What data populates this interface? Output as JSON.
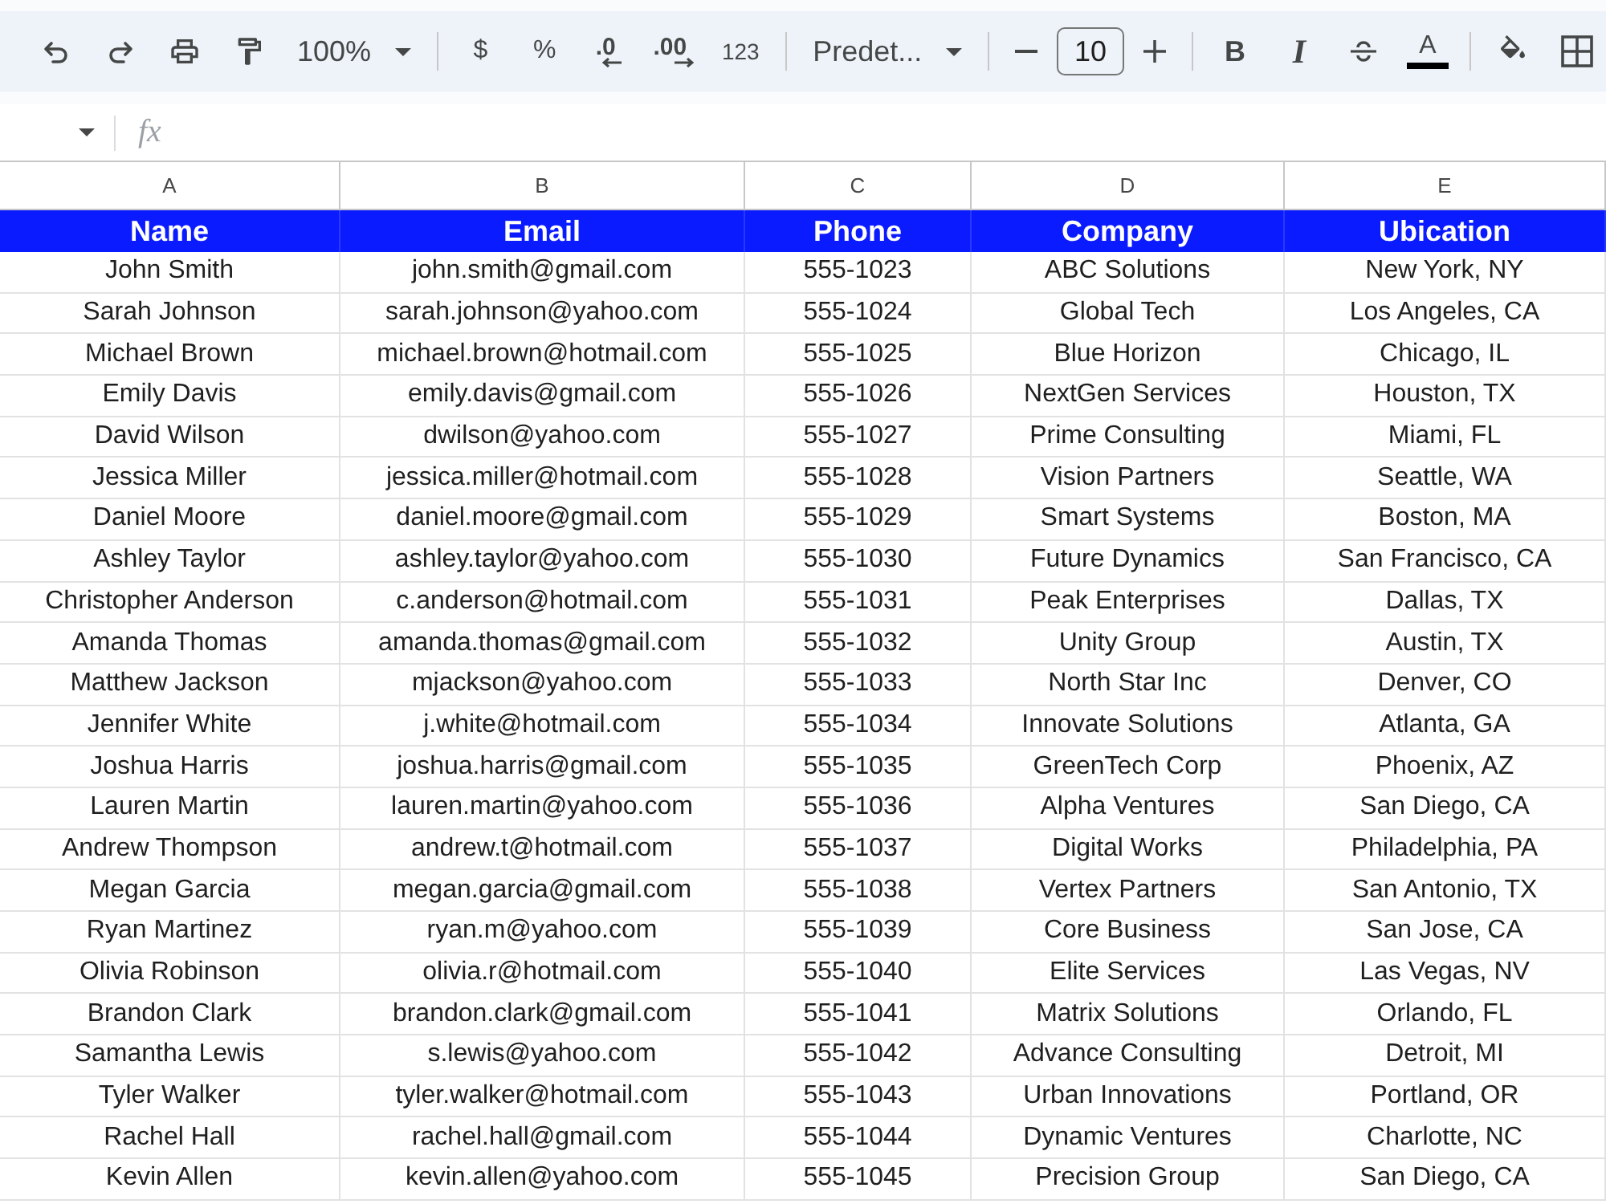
{
  "toolbar": {
    "zoom": "100%",
    "currency": "$",
    "percent": "%",
    "decrease_decimal": ".0",
    "increase_decimal": ".00",
    "number_format": "123",
    "font": "Predet...",
    "font_size": "10",
    "bold": "B",
    "italic": "I",
    "text_color": "A"
  },
  "formula_bar": {
    "function_label": "fx"
  },
  "sheet": {
    "column_letters": [
      "A",
      "B",
      "C",
      "D",
      "E"
    ],
    "header": [
      "Name",
      "Email",
      "Phone",
      "Company",
      "Ubication"
    ],
    "rows": [
      [
        "John Smith",
        "john.smith@gmail.com",
        "555-1023",
        "ABC Solutions",
        "New York, NY"
      ],
      [
        "Sarah Johnson",
        "sarah.johnson@yahoo.com",
        "555-1024",
        "Global Tech",
        "Los Angeles, CA"
      ],
      [
        "Michael Brown",
        "michael.brown@hotmail.com",
        "555-1025",
        "Blue Horizon",
        "Chicago, IL"
      ],
      [
        "Emily Davis",
        "emily.davis@gmail.com",
        "555-1026",
        "NextGen Services",
        "Houston, TX"
      ],
      [
        "David Wilson",
        "dwilson@yahoo.com",
        "555-1027",
        "Prime Consulting",
        "Miami, FL"
      ],
      [
        "Jessica Miller",
        "jessica.miller@hotmail.com",
        "555-1028",
        "Vision Partners",
        "Seattle, WA"
      ],
      [
        "Daniel Moore",
        "daniel.moore@gmail.com",
        "555-1029",
        "Smart Systems",
        "Boston, MA"
      ],
      [
        "Ashley Taylor",
        "ashley.taylor@yahoo.com",
        "555-1030",
        "Future Dynamics",
        "San Francisco, CA"
      ],
      [
        "Christopher Anderson",
        "c.anderson@hotmail.com",
        "555-1031",
        "Peak Enterprises",
        "Dallas, TX"
      ],
      [
        "Amanda Thomas",
        "amanda.thomas@gmail.com",
        "555-1032",
        "Unity Group",
        "Austin, TX"
      ],
      [
        "Matthew Jackson",
        "mjackson@yahoo.com",
        "555-1033",
        "North Star Inc",
        "Denver, CO"
      ],
      [
        "Jennifer White",
        "j.white@hotmail.com",
        "555-1034",
        "Innovate Solutions",
        "Atlanta, GA"
      ],
      [
        "Joshua Harris",
        "joshua.harris@gmail.com",
        "555-1035",
        "GreenTech Corp",
        "Phoenix, AZ"
      ],
      [
        "Lauren Martin",
        "lauren.martin@yahoo.com",
        "555-1036",
        "Alpha Ventures",
        "San Diego, CA"
      ],
      [
        "Andrew Thompson",
        "andrew.t@hotmail.com",
        "555-1037",
        "Digital Works",
        "Philadelphia, PA"
      ],
      [
        "Megan Garcia",
        "megan.garcia@gmail.com",
        "555-1038",
        "Vertex Partners",
        "San Antonio, TX"
      ],
      [
        "Ryan Martinez",
        "ryan.m@yahoo.com",
        "555-1039",
        "Core Business",
        "San Jose, CA"
      ],
      [
        "Olivia Robinson",
        "olivia.r@hotmail.com",
        "555-1040",
        "Elite Services",
        "Las Vegas, NV"
      ],
      [
        "Brandon Clark",
        "brandon.clark@gmail.com",
        "555-1041",
        "Matrix Solutions",
        "Orlando, FL"
      ],
      [
        "Samantha Lewis",
        "s.lewis@yahoo.com",
        "555-1042",
        "Advance Consulting",
        "Detroit, MI"
      ],
      [
        "Tyler Walker",
        "tyler.walker@hotmail.com",
        "555-1043",
        "Urban Innovations",
        "Portland, OR"
      ],
      [
        "Rachel Hall",
        "rachel.hall@gmail.com",
        "555-1044",
        "Dynamic Ventures",
        "Charlotte, NC"
      ],
      [
        "Kevin Allen",
        "kevin.allen@yahoo.com",
        "555-1045",
        "Precision Group",
        "San Diego, CA"
      ]
    ]
  }
}
